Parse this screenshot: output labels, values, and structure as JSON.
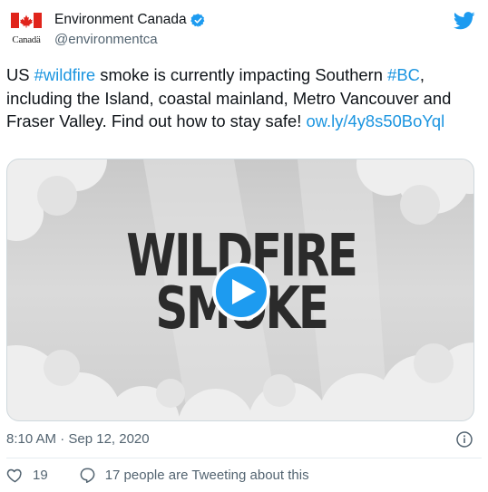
{
  "account": {
    "display_name": "Environment Canada",
    "handle": "@environmentca",
    "wordmark": "Canadä",
    "verified": true
  },
  "tweet": {
    "segments": [
      {
        "text": "US ",
        "type": "text"
      },
      {
        "text": "#wildfire",
        "type": "hashtag"
      },
      {
        "text": " smoke is currently impacting Southern ",
        "type": "text"
      },
      {
        "text": "#BC",
        "type": "hashtag"
      },
      {
        "text": ", including the Island, coastal mainland, Metro Vancouver and Fraser Valley. Find out how to stay safe! ",
        "type": "text"
      },
      {
        "text": "ow.ly/4y8s50BoYql",
        "type": "link"
      }
    ]
  },
  "media": {
    "title_line1": "WILDFIRE",
    "title_line2": "SMOKE",
    "type": "video"
  },
  "meta": {
    "timestamp": "8:10 AM · Sep 12, 2020"
  },
  "engagement": {
    "likes": "19",
    "conversation": "17 people are Tweeting about this"
  },
  "icons": {
    "brand": "twitter-bird-icon",
    "verified": "verified-badge-icon",
    "info": "info-icon",
    "like": "heart-icon",
    "reply": "speech-bubble-icon",
    "play": "play-icon"
  },
  "colors": {
    "accent": "#1d9bf0",
    "link": "#1b95e0",
    "flag_red": "#e0241b",
    "muted": "#536471"
  }
}
